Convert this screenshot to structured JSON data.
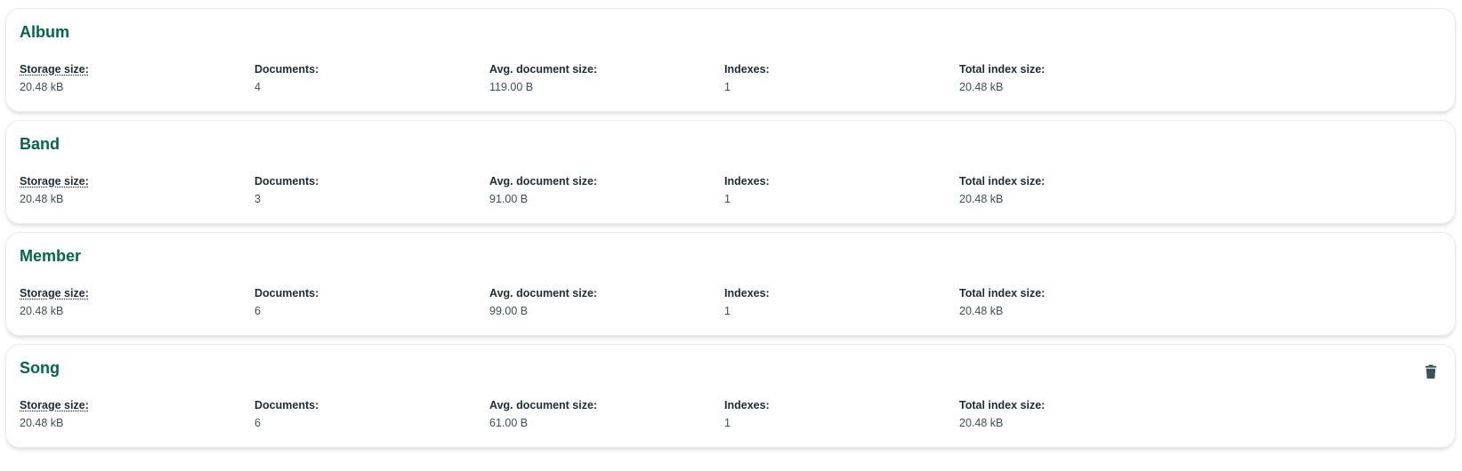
{
  "labels": {
    "storage_size": "Storage size:",
    "documents": "Documents:",
    "avg_document_size": "Avg. document size:",
    "indexes": "Indexes:",
    "total_index_size": "Total index size:"
  },
  "collections": [
    {
      "name": "Album",
      "storage_size": "20.48 kB",
      "documents": "4",
      "avg_document_size": "119.00 B",
      "indexes": "1",
      "total_index_size": "20.48 kB"
    },
    {
      "name": "Band",
      "storage_size": "20.48 kB",
      "documents": "3",
      "avg_document_size": "91.00 B",
      "indexes": "1",
      "total_index_size": "20.48 kB"
    },
    {
      "name": "Member",
      "storage_size": "20.48 kB",
      "documents": "6",
      "avg_document_size": "99.00 B",
      "indexes": "1",
      "total_index_size": "20.48 kB"
    },
    {
      "name": "Song",
      "storage_size": "20.48 kB",
      "documents": "6",
      "avg_document_size": "61.00 B",
      "indexes": "1",
      "total_index_size": "20.48 kB",
      "delete_icon": "trash-icon"
    }
  ],
  "colors": {
    "title": "#00684a",
    "label": "#1c2d38",
    "value": "#3d4f58",
    "icon": "#3d4f58"
  }
}
